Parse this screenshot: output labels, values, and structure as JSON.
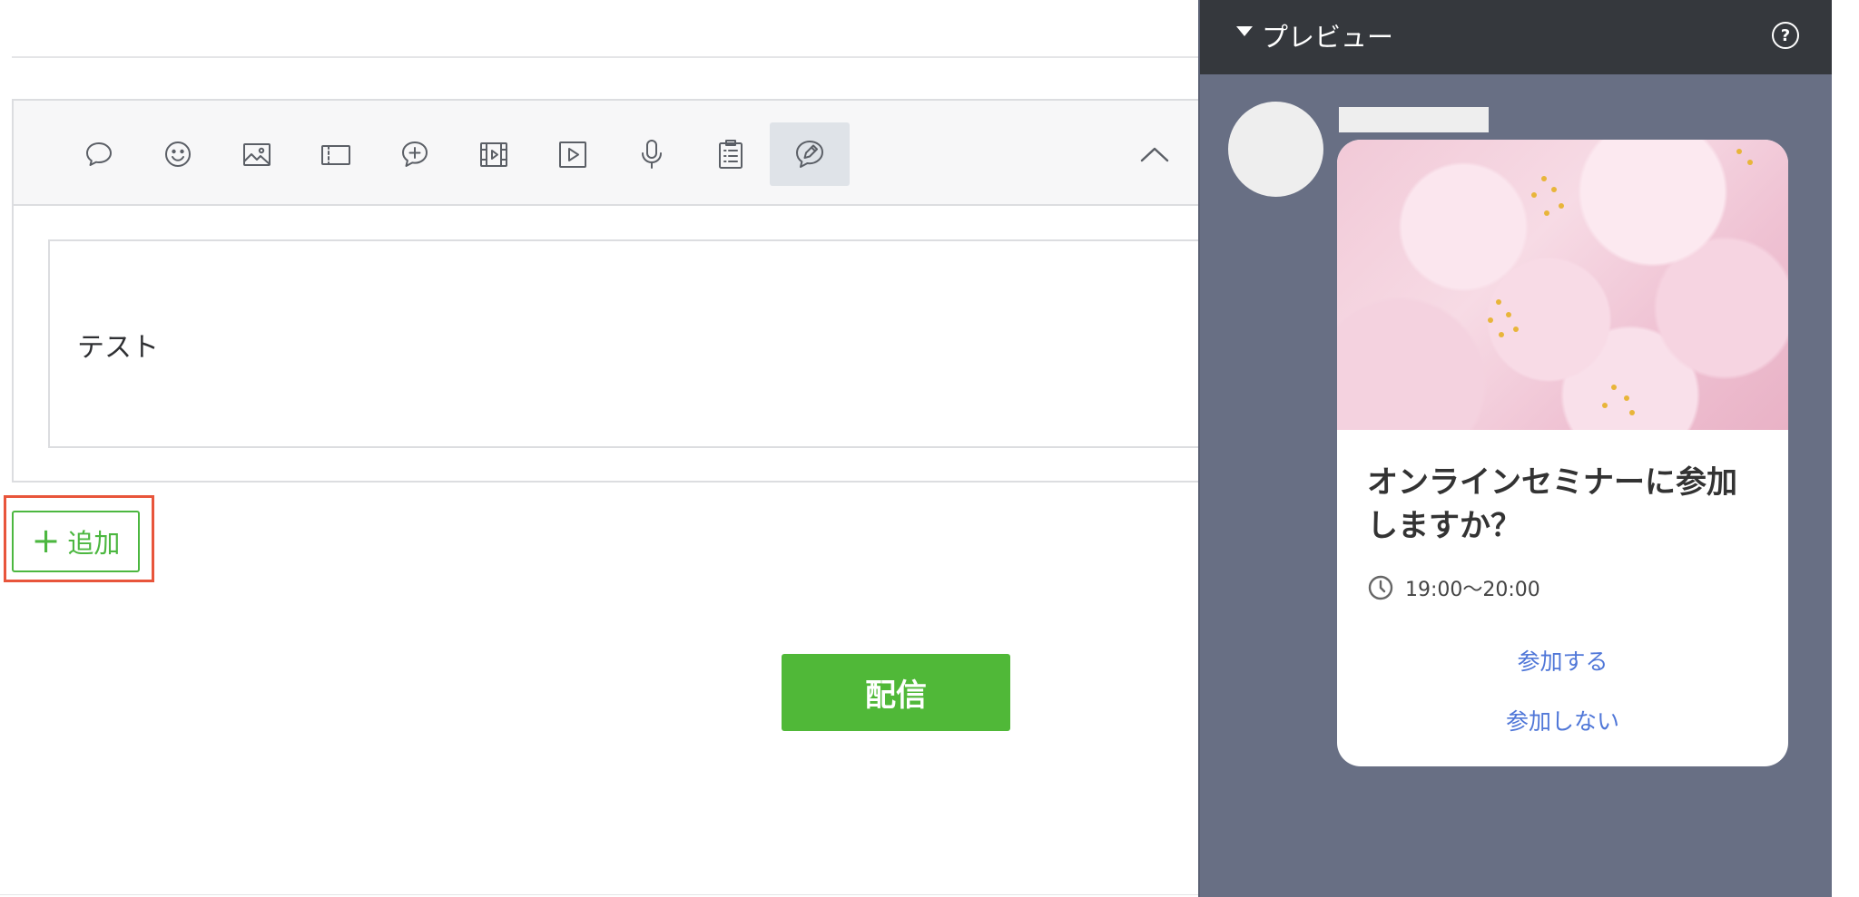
{
  "editor": {
    "toolbar": {
      "tools": [
        {
          "name": "text-bubble-icon",
          "active": false
        },
        {
          "name": "emoji-icon",
          "active": false
        },
        {
          "name": "image-icon",
          "active": false
        },
        {
          "name": "coupon-icon",
          "active": false
        },
        {
          "name": "rich-message-icon",
          "active": false
        },
        {
          "name": "rich-video-icon",
          "active": false
        },
        {
          "name": "video-icon",
          "active": false
        },
        {
          "name": "microphone-icon",
          "active": false
        },
        {
          "name": "survey-icon",
          "active": false
        },
        {
          "name": "card-message-icon",
          "active": true
        }
      ],
      "collapse_icon": "chevron-up-icon"
    },
    "message_text": "テスト",
    "add_button_label": "追加",
    "add_button_plus": "+",
    "send_button_label": "配信"
  },
  "preview": {
    "header_title": "プレビュー",
    "help_label": "?",
    "card": {
      "title": "オンラインセミナーに参加しますか？",
      "time": "19:00〜20:00",
      "actions": [
        "参加する",
        "参加しない"
      ]
    }
  },
  "colors": {
    "accent_green": "#50b838",
    "highlight_red": "#e8553b",
    "preview_background": "#686f84",
    "link_blue": "#5077d8"
  }
}
